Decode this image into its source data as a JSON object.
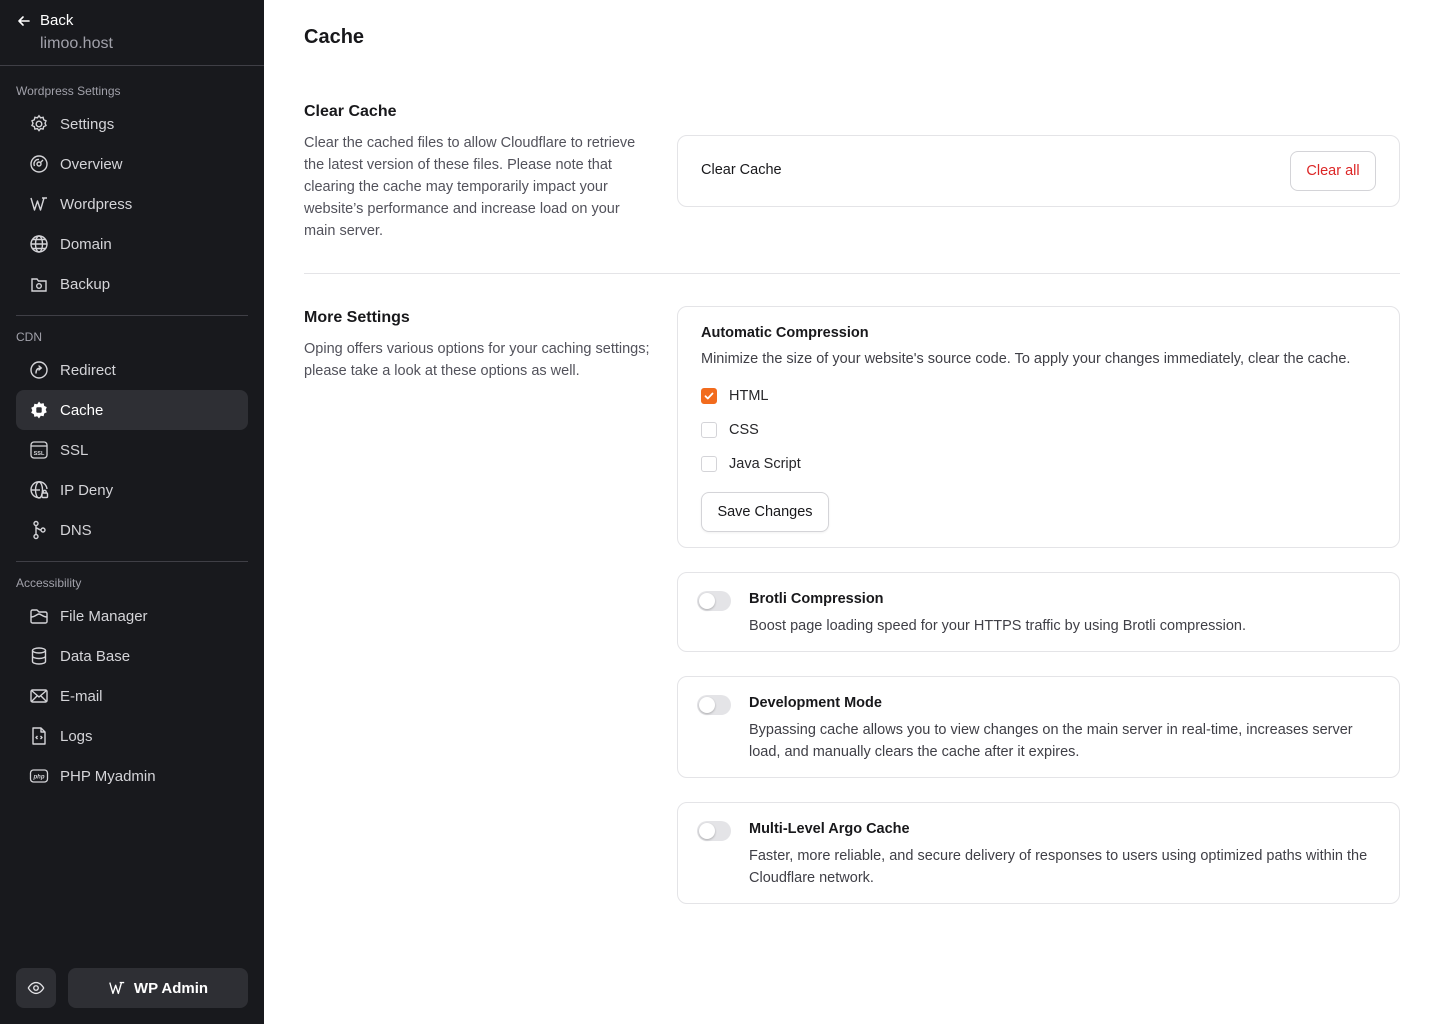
{
  "sidebar": {
    "back_label": "Back",
    "site_name": "limoo.host",
    "sections": [
      {
        "label": "Wordpress Settings"
      },
      {
        "label": "CDN"
      },
      {
        "label": "Accessibility"
      }
    ],
    "items": [
      {
        "label": "Settings",
        "icon": "gear-icon"
      },
      {
        "label": "Overview",
        "icon": "gauge-icon"
      },
      {
        "label": "Wordpress",
        "icon": "wordpress-icon"
      },
      {
        "label": "Domain",
        "icon": "globe-icon"
      },
      {
        "label": "Backup",
        "icon": "backup-icon"
      },
      {
        "label": "Redirect",
        "icon": "redirect-icon"
      },
      {
        "label": "Cache",
        "icon": "cache-icon",
        "active": true
      },
      {
        "label": "SSL",
        "icon": "ssl-icon"
      },
      {
        "label": "IP Deny",
        "icon": "globe-lock-icon"
      },
      {
        "label": "DNS",
        "icon": "dns-icon"
      },
      {
        "label": "File Manager",
        "icon": "folder-icon"
      },
      {
        "label": "Data Base",
        "icon": "database-icon"
      },
      {
        "label": "E-mail",
        "icon": "mail-icon"
      },
      {
        "label": "Logs",
        "icon": "logs-icon"
      },
      {
        "label": "PHP Myadmin",
        "icon": "php-icon"
      }
    ],
    "wp_admin_label": "WP Admin"
  },
  "main": {
    "title": "Cache",
    "clear_cache": {
      "title": "Clear Cache",
      "description": "Clear the cached files to allow Cloudflare to retrieve the latest version of these files. Please note that clearing the cache may temporarily impact your website’s performance and increase load on your main server.",
      "card_label": "Clear Cache",
      "button_label": "Clear all"
    },
    "more_settings": {
      "title": "More Settings",
      "description": "Oping offers various options for your caching settings; please take a look at these options as well."
    },
    "compression": {
      "title": "Automatic Compression",
      "description": "Minimize the size of your website's source code. To apply your changes immediately, clear the cache.",
      "options": [
        {
          "label": "HTML",
          "checked": true
        },
        {
          "label": "CSS",
          "checked": false
        },
        {
          "label": "Java Script",
          "checked": false
        }
      ],
      "save_label": "Save Changes"
    },
    "toggles": [
      {
        "title": "Brotli Compression",
        "description": "Boost page loading speed for your HTTPS traffic by using Brotli compression.",
        "enabled": false
      },
      {
        "title": "Development Mode",
        "description": "Bypassing cache allows you to view changes on the main server in real-time, increases server load, and manually clears the cache after it expires.",
        "enabled": false
      },
      {
        "title": "Multi-Level Argo Cache",
        "description": "Faster, more reliable, and secure delivery of responses to users using optimized paths within the Cloudflare network.",
        "enabled": false
      }
    ]
  },
  "colors": {
    "sidebar_bg": "#18191d",
    "active_item_bg": "#2e2f34",
    "accent": "#f26b1d",
    "danger": "#dc2626"
  }
}
